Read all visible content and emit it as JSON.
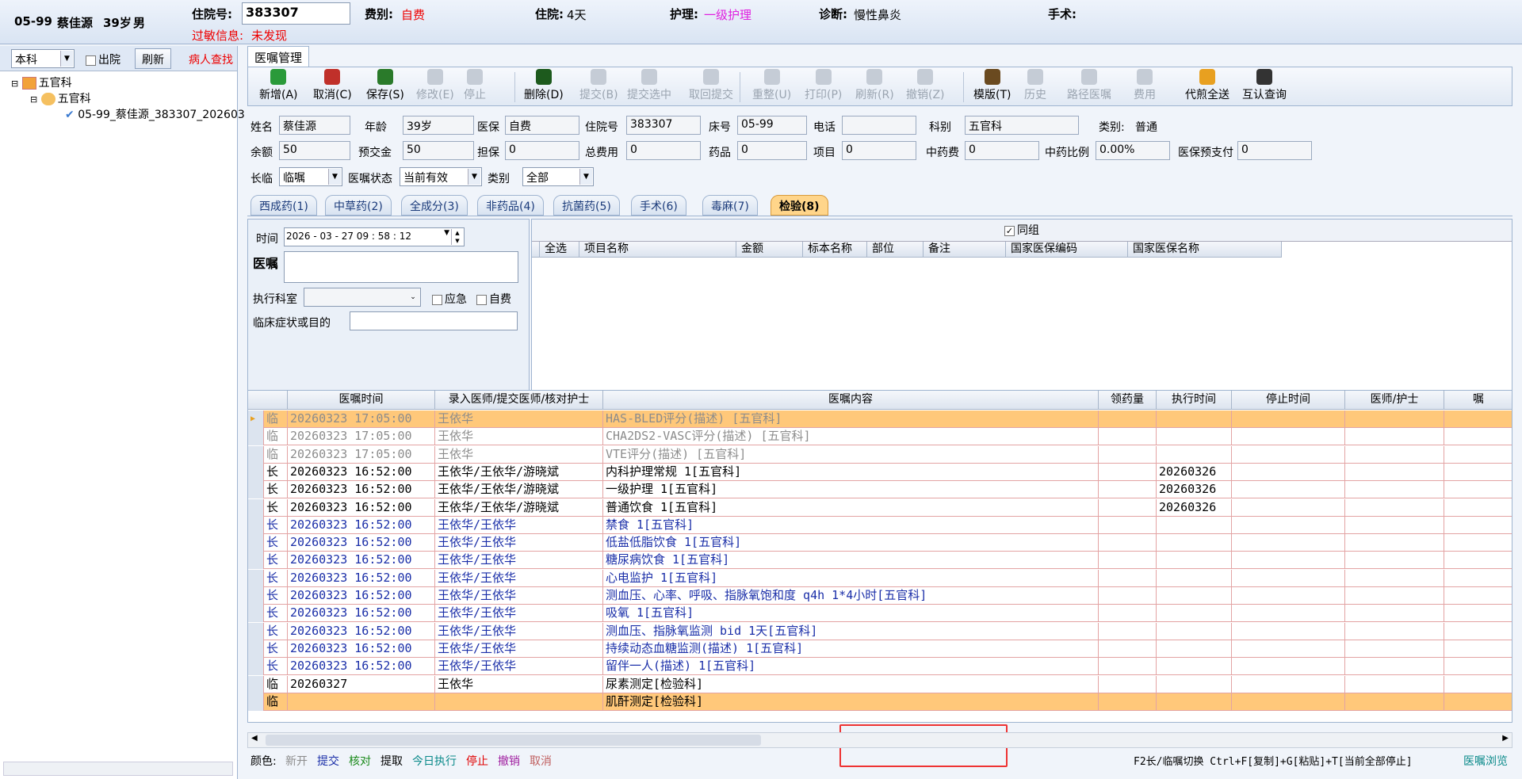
{
  "header": {
    "bed_name": "05-99",
    "patient_name": "蔡佳源",
    "age": "39岁",
    "sex": "男",
    "admission_label": "住院号:",
    "admission_value": "383307",
    "fee_label": "费别:",
    "fee_value": "自费",
    "days_label": "住院:",
    "days_value": "4天",
    "nursing_label": "护理:",
    "nursing_value": "一级护理",
    "diagnosis_label": "诊断:",
    "diagnosis_value": "慢性鼻炎",
    "surgery_label": "手术:",
    "allergy_label": "过敏信息:",
    "allergy_value": "未发现"
  },
  "left": {
    "dept_select": "本科",
    "discharge_label": "出院",
    "refresh_label": "刷新",
    "find_patient_label": "病人查找",
    "tree": [
      "五官科",
      "五官科",
      "05-99_蔡佳源_383307_202603"
    ]
  },
  "main_tab": "医嘱管理",
  "toolbar": [
    {
      "label": "新增(A)",
      "icon": "add-icon",
      "color": "#2a9a3a",
      "enabled": true
    },
    {
      "label": "取消(C)",
      "icon": "undo-icon",
      "color": "#c0302a",
      "enabled": true
    },
    {
      "label": "保存(S)",
      "icon": "save-icon",
      "color": "#2a7a2a",
      "enabled": true
    },
    {
      "label": "修改(E)",
      "icon": "edit-icon",
      "color": "#888",
      "enabled": false
    },
    {
      "label": "停止",
      "icon": "stop-icon",
      "color": "#888",
      "enabled": false
    },
    {
      "label": "删除(D)",
      "icon": "delete-icon",
      "color": "#1d5a1d",
      "enabled": true
    },
    {
      "label": "提交(B)",
      "icon": "submit-icon",
      "color": "#888",
      "enabled": false
    },
    {
      "label": "提交选中",
      "icon": "submit-selected-icon",
      "color": "#888",
      "enabled": false
    },
    {
      "label": "取回提交",
      "icon": "retrieve-icon",
      "color": "#888",
      "enabled": false
    },
    {
      "label": "重整(U)",
      "icon": "reorganize-icon",
      "color": "#888",
      "enabled": false
    },
    {
      "label": "打印(P)",
      "icon": "print-icon",
      "color": "#888",
      "enabled": false
    },
    {
      "label": "刷新(R)",
      "icon": "refresh-icon",
      "color": "#888",
      "enabled": false
    },
    {
      "label": "撤销(Z)",
      "icon": "revoke-icon",
      "color": "#888",
      "enabled": false
    },
    {
      "label": "模版(T)",
      "icon": "template-icon",
      "color": "#6a4a20",
      "enabled": true
    },
    {
      "label": "历史",
      "icon": "history-icon",
      "color": "#888",
      "enabled": false
    },
    {
      "label": "路径医嘱",
      "icon": "pathway-icon",
      "color": "#888",
      "enabled": false
    },
    {
      "label": "费用",
      "icon": "fee-icon",
      "color": "#888",
      "enabled": false
    },
    {
      "label": "代煎全送",
      "icon": "decoct-icon",
      "color": "#e8a020",
      "enabled": true
    },
    {
      "label": "互认查询",
      "icon": "search-icon",
      "color": "#333",
      "enabled": true
    }
  ],
  "patient": {
    "name_label": "姓名",
    "name": "蔡佳源",
    "age_label": "年龄",
    "age": "39岁",
    "insurance_label": "医保",
    "insurance": "自费",
    "admission_label": "住院号",
    "admission": "383307",
    "bed_label": "床号",
    "bed": "05-99",
    "phone_label": "电话",
    "phone": "",
    "dept_label": "科别",
    "dept": "五官科",
    "category_label": "类别:",
    "category": "普通",
    "balance_label": "余额",
    "balance": "50",
    "prepay_label": "预交金",
    "prepay": "50",
    "guarantee_label": "担保",
    "guarantee": "0",
    "total_label": "总费用",
    "total": "0",
    "drug_label": "药品",
    "drug": "0",
    "item_label": "项目",
    "item": "0",
    "herb_label": "中药费",
    "herb": "0",
    "herb_ratio_label": "中药比例",
    "herb_ratio": "0.00%",
    "ins_prepay_label": "医保预支付",
    "ins_prepay": "0"
  },
  "filters": {
    "long_label": "长临",
    "long_value": "临嘱",
    "status_label": "医嘱状态",
    "status_value": "当前有效",
    "type_label": "类别",
    "type_value": "全部"
  },
  "order_tabs": [
    "西成药(1)",
    "中草药(2)",
    "全成分(3)",
    "非药品(4)",
    "抗菌药(5)",
    "手术(6)",
    "毒麻(7)",
    "检验(8)"
  ],
  "entry": {
    "time_label": "时间",
    "time_value": "2026 - 03 - 27   09 : 58 : 12",
    "order_label": "医嘱",
    "dept_label": "执行科室",
    "urgent_label": "应急",
    "selfpay_label": "自费",
    "symptom_label": "临床症状或目的"
  },
  "lab_grid": {
    "group_label": "同组",
    "headers": [
      "全选",
      "项目名称",
      "金额",
      "标本名称",
      "部位",
      "备注",
      "国家医保编码",
      "国家医保名称"
    ]
  },
  "order_grid": {
    "headers": [
      "医嘱时间",
      "录入医师/提交医师/核对护士",
      "医嘱内容",
      "领药量",
      "执行时间",
      "停止时间",
      "医师/护士",
      "嘱"
    ],
    "rows": [
      {
        "type": "临",
        "time": "20260323 17:05:00",
        "doctor": "王依华",
        "content": "HAS-BLED评分(描述)   [五官科]",
        "exec": "",
        "style": "gray"
      },
      {
        "type": "临",
        "time": "20260323 17:05:00",
        "doctor": "王依华",
        "content": "CHA2DS2-VASC评分(描述)   [五官科]",
        "exec": "",
        "style": "gray"
      },
      {
        "type": "临",
        "time": "20260323 17:05:00",
        "doctor": "王依华",
        "content": "VTE评分(描述)   [五官科]",
        "exec": "",
        "style": "gray"
      },
      {
        "type": "长",
        "time": "20260323 16:52:00",
        "doctor": "王依华/王依华/游晓斌",
        "content": "内科护理常规   1[五官科]",
        "exec": "20260326",
        "style": "black"
      },
      {
        "type": "长",
        "time": "20260323 16:52:00",
        "doctor": "王依华/王依华/游晓斌",
        "content": "一级护理   1[五官科]",
        "exec": "20260326",
        "style": "black"
      },
      {
        "type": "长",
        "time": "20260323 16:52:00",
        "doctor": "王依华/王依华/游晓斌",
        "content": "普通饮食   1[五官科]",
        "exec": "20260326",
        "style": "black"
      },
      {
        "type": "长",
        "time": "20260323 16:52:00",
        "doctor": "王依华/王依华",
        "content": "禁食   1[五官科]",
        "exec": "",
        "style": "blue"
      },
      {
        "type": "长",
        "time": "20260323 16:52:00",
        "doctor": "王依华/王依华",
        "content": "低盐低脂饮食   1[五官科]",
        "exec": "",
        "style": "blue"
      },
      {
        "type": "长",
        "time": "20260323 16:52:00",
        "doctor": "王依华/王依华",
        "content": "糖尿病饮食   1[五官科]",
        "exec": "",
        "style": "blue"
      },
      {
        "type": "长",
        "time": "20260323 16:52:00",
        "doctor": "王依华/王依华",
        "content": "心电监护   1[五官科]",
        "exec": "",
        "style": "blue"
      },
      {
        "type": "长",
        "time": "20260323 16:52:00",
        "doctor": "王依华/王依华",
        "content": "测血压、心率、呼吸、指脉氧饱和度  q4h  1*4小时[五官科]",
        "exec": "",
        "style": "blue"
      },
      {
        "type": "长",
        "time": "20260323 16:52:00",
        "doctor": "王依华/王依华",
        "content": "吸氧   1[五官科]",
        "exec": "",
        "style": "blue"
      },
      {
        "type": "长",
        "time": "20260323 16:52:00",
        "doctor": "王依华/王依华",
        "content": "测血压、指脉氧监测  bid  1天[五官科]",
        "exec": "",
        "style": "blue"
      },
      {
        "type": "长",
        "time": "20260323 16:52:00",
        "doctor": "王依华/王依华",
        "content": "持续动态血糖监测(描述)   1[五官科]",
        "exec": "",
        "style": "blue"
      },
      {
        "type": "长",
        "time": "20260323 16:52:00",
        "doctor": "王依华/王依华",
        "content": "留伴一人(描述)   1[五官科]",
        "exec": "",
        "style": "blue"
      },
      {
        "type": "临",
        "time": "20260327",
        "doctor": "王依华",
        "content": "尿素测定[检验科]",
        "exec": "",
        "style": "black"
      },
      {
        "type": "临",
        "time": "",
        "doctor": "",
        "content": "肌酐测定[检验科]",
        "exec": "",
        "style": "black"
      }
    ]
  },
  "status": {
    "color_label": "颜色:",
    "legend": [
      {
        "text": "新开",
        "color": "#8c8c8c"
      },
      {
        "text": "提交",
        "color": "#1a2ea8"
      },
      {
        "text": "核对",
        "color": "#1a8a1a"
      },
      {
        "text": "提取",
        "color": "#000000"
      },
      {
        "text": "今日执行",
        "color": "#0a8a8a"
      },
      {
        "text": "停止",
        "color": "#e00000"
      },
      {
        "text": "撤销",
        "color": "#a020a0"
      },
      {
        "text": "取消",
        "color": "#c06060"
      }
    ],
    "shortcuts": "F2长/临嘱切换 Ctrl+F[复制]+G[粘贴]+T[当前全部停止]",
    "browse": "医嘱浏览"
  }
}
